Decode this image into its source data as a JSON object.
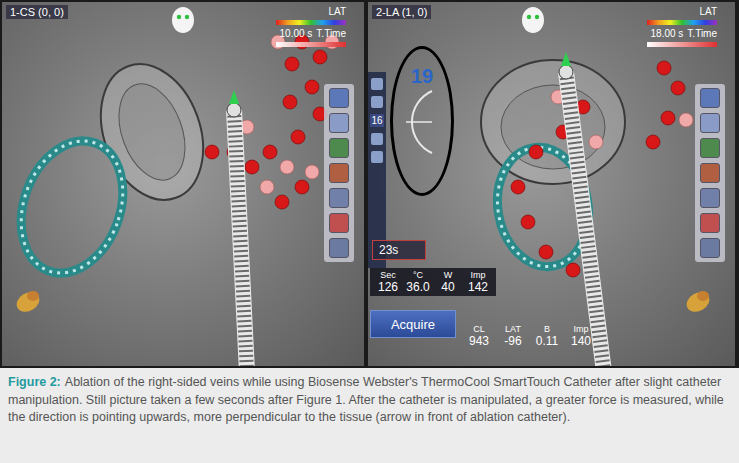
{
  "figure": {
    "panels": [
      {
        "label": "1-CS (0, 0)",
        "lat_label": "LAT",
        "ttime_label": "T.Time",
        "ttime_value": "10.00 s"
      },
      {
        "label": "2-LA (1, 0)",
        "lat_label": "LAT",
        "ttime_label": "T.Time",
        "ttime_value": "18.00 s"
      }
    ],
    "force": {
      "value": "19",
      "contact_index": "16"
    },
    "ablation": {
      "timer": "23s",
      "headers": [
        "Sec",
        "°C",
        "W",
        "Imp"
      ],
      "values": [
        "126",
        "36.0",
        "40",
        "142"
      ]
    },
    "acquire_button": "Acquire",
    "point_info": {
      "headers": [
        "CL",
        "LAT",
        "B",
        "Imp"
      ],
      "values": [
        "943",
        "-96",
        "0.11",
        "140"
      ]
    }
  },
  "caption": {
    "label": "Figure 2:",
    "text": "Ablation of the right-sided veins while using Biosense Webster's ThermoCool SmartTouch Catheter after slight catheter manipulation. Still picture taken a few seconds after Figure 1. After the catheter is manipulated, a greater force is measured, while the direction is pointing upwards, more perpendicular to the tissue (arrow in front of ablation catheter)."
  }
}
